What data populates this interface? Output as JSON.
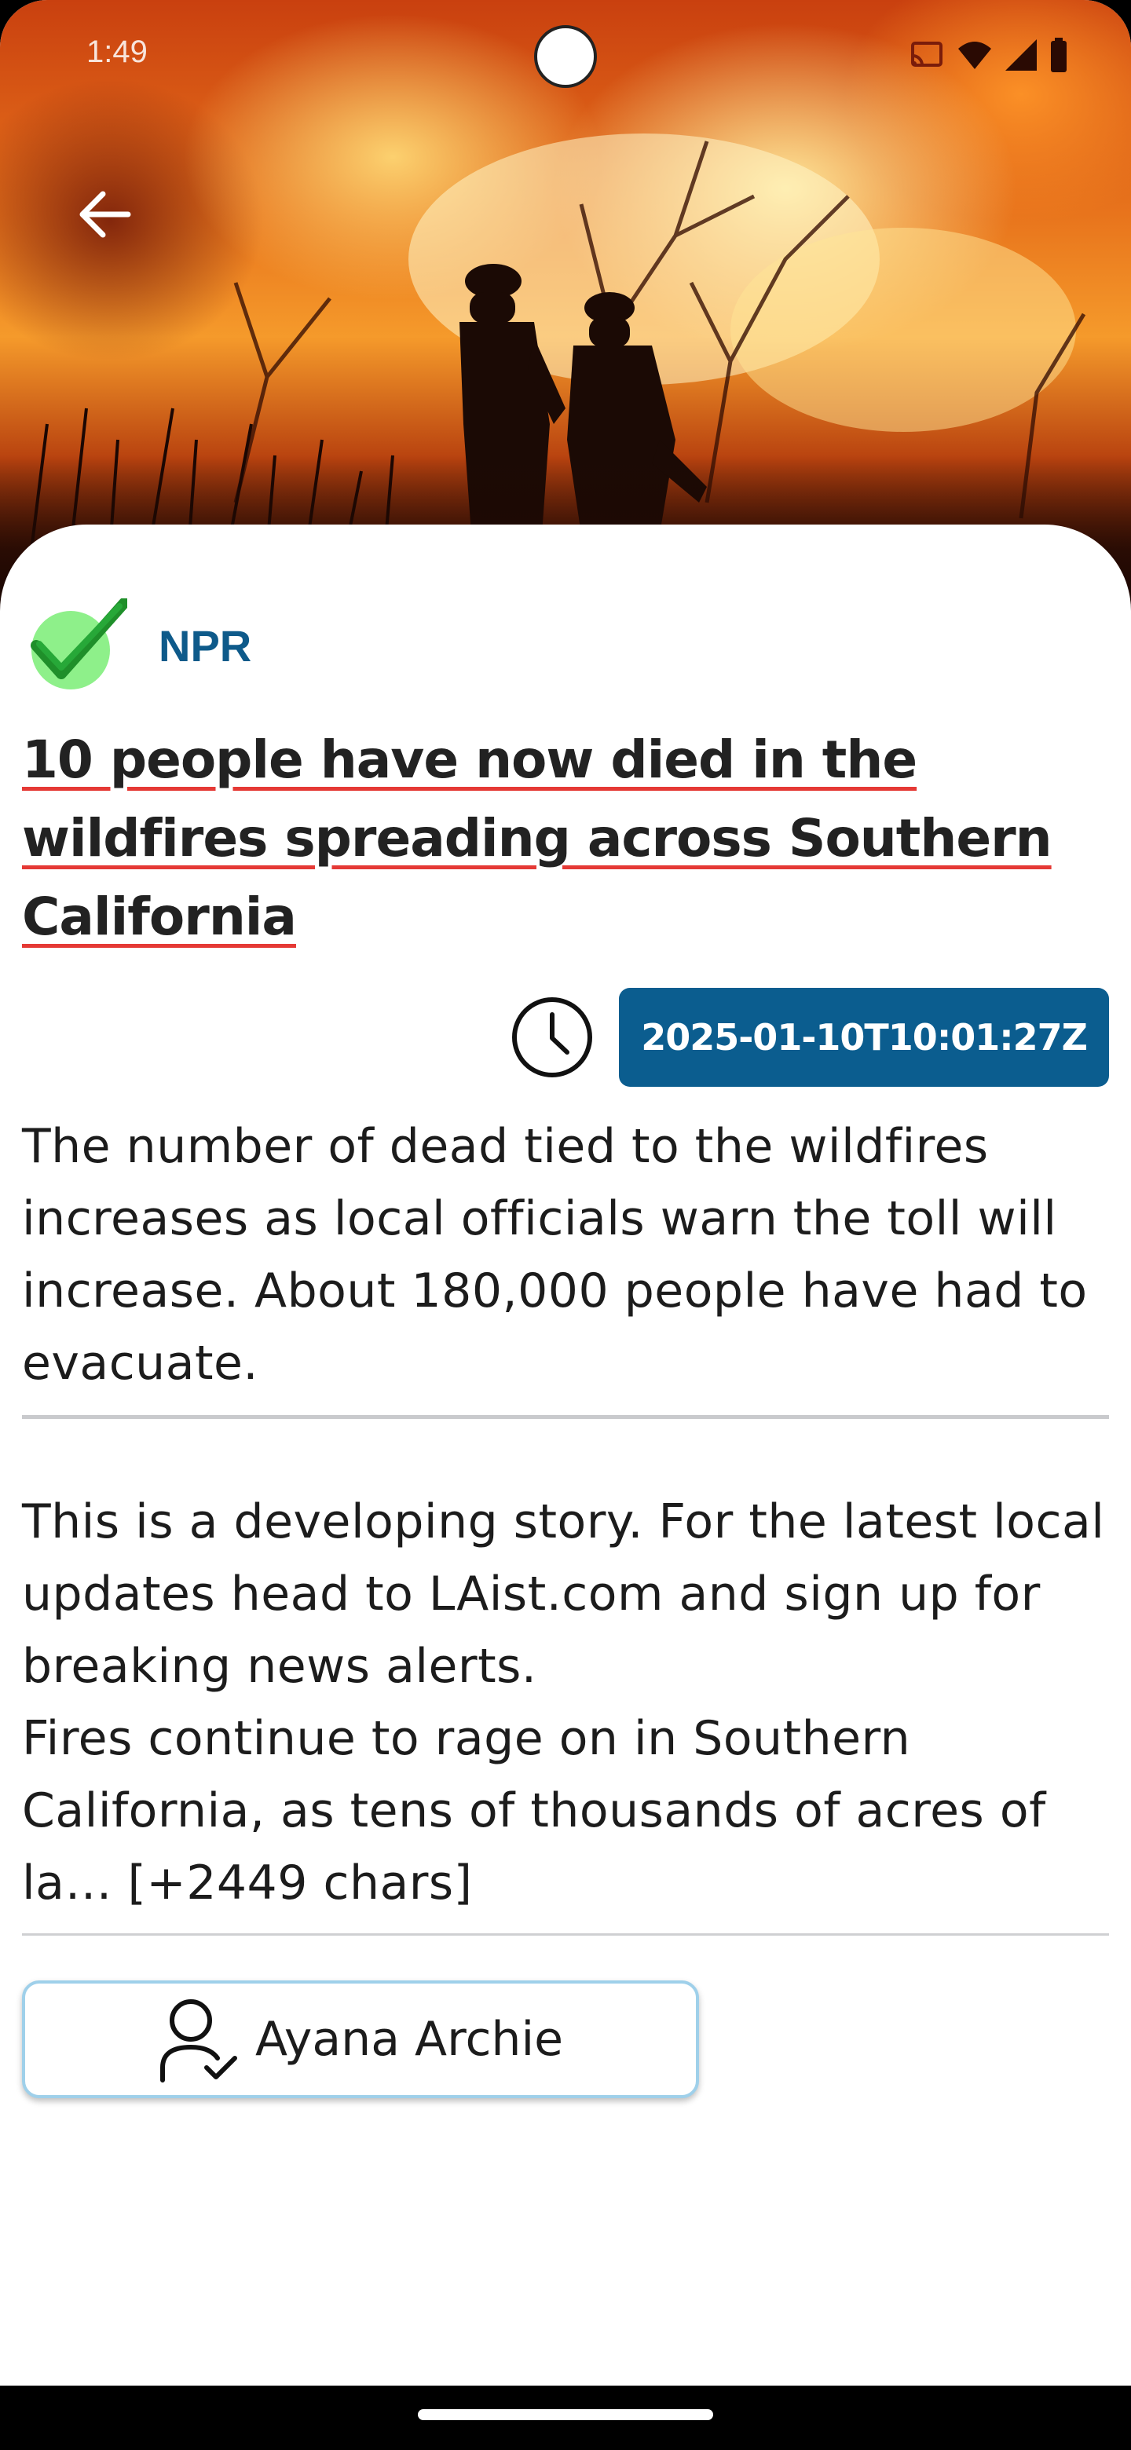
{
  "status_bar": {
    "time": "1:49",
    "icons": [
      "cast-icon",
      "wifi-icon",
      "signal-icon",
      "battery-icon"
    ]
  },
  "hero": {
    "image_description_icon": "wildfire-photo"
  },
  "article": {
    "source": "NPR",
    "title": "10 people have now died in the wildfires spreading across Southern California",
    "published_at": "2025-01-10T10:01:27Z",
    "description": "The number of dead tied to the wildfires increases as local officials warn the toll will increase. About 180,000 people have had to evacuate.",
    "content": "This is a developing story. For the latest local updates head to LAist.com and sign up for breaking news alerts.\nFires continue to rage on in Southern California, as tens of thousands of acres of la… [+2449 chars]",
    "author": "Ayana Archie"
  },
  "colors": {
    "source": "#0e5a8a",
    "date_chip": "#0b5d8f",
    "title_underline": "#e53935",
    "verified_check": "#3cb043"
  }
}
